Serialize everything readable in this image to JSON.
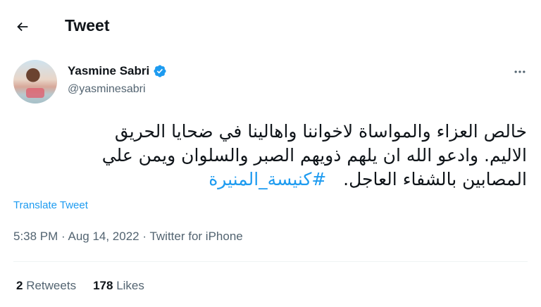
{
  "header": {
    "title": "Tweet",
    "back_icon": "arrow-left-icon"
  },
  "author": {
    "display_name": "Yasmine Sabri",
    "handle": "@yasminesabri",
    "verified_icon": "verified-badge-icon",
    "verified_color": "#1d9bf0"
  },
  "more_icon": "more-horizontal-icon",
  "tweet": {
    "line1": "خالص العزاء والمواساة لاخواننا واهالينا في ضحايا الحريق",
    "line2": "الاليم. وادعو الله ان يلهم ذويهم الصبر والسلوان ويمن علي",
    "line3_text": "المصابين بالشفاء العاجل.",
    "hashtag": "#كنيسة_المنيرة",
    "hashtag_color": "#1d9bf0"
  },
  "translate_label": "Translate Tweet",
  "meta": {
    "time": "5:38 PM",
    "separator": " · ",
    "date": "Aug 14, 2022",
    "source": "Twitter for iPhone"
  },
  "stats": {
    "retweets_count": "2",
    "retweets_label": "Retweets",
    "likes_count": "178",
    "likes_label": "Likes"
  }
}
